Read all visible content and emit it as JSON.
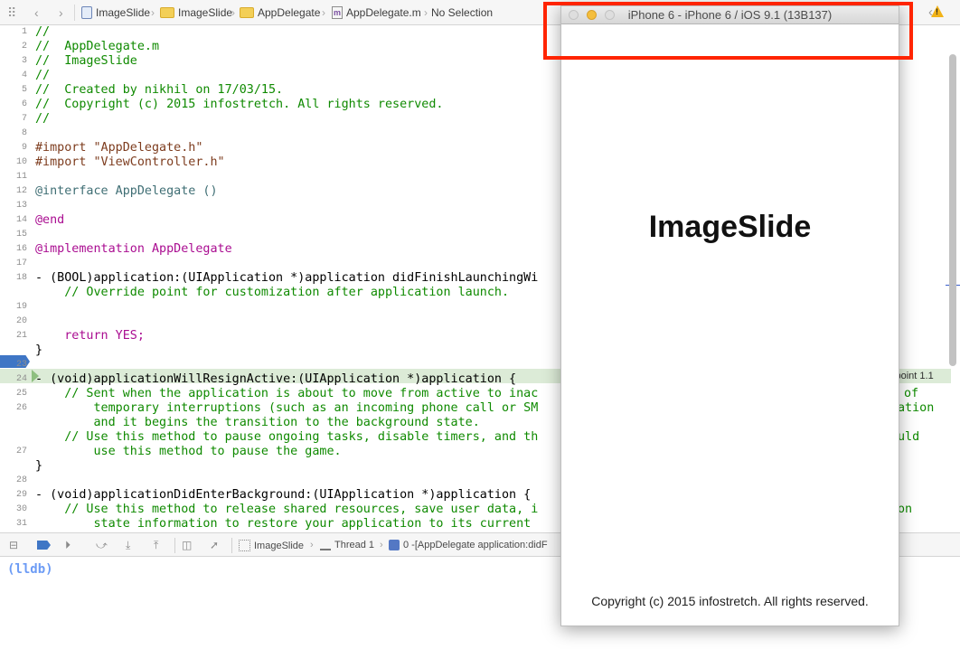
{
  "jumpbar": {
    "crumbs": [
      "ImageSlide",
      "ImageSlide",
      "AppDelegate",
      "AppDelegate.m",
      "No Selection"
    ],
    "warning_icon": "warning-triangle-icon",
    "colors": {
      "warning": "#f2b318"
    }
  },
  "editor": {
    "lines": [
      {
        "n": "1",
        "t": "//"
      },
      {
        "n": "2",
        "t": "//  AppDelegate.m"
      },
      {
        "n": "3",
        "t": "//  ImageSlide"
      },
      {
        "n": "4",
        "t": "//"
      },
      {
        "n": "5",
        "t": "//  Created by nikhil on 17/03/15."
      },
      {
        "n": "6",
        "t": "//  Copyright (c) 2015 infostretch. All rights reserved."
      },
      {
        "n": "7",
        "t": "//"
      },
      {
        "n": "8",
        "t": ""
      },
      {
        "n": "9",
        "t": "#import \"AppDelegate.h\""
      },
      {
        "n": "10",
        "t": "#import \"ViewController.h\""
      },
      {
        "n": "11",
        "t": ""
      },
      {
        "n": "12",
        "t": "@interface AppDelegate ()"
      },
      {
        "n": "13",
        "t": ""
      },
      {
        "n": "14",
        "t": "@end"
      },
      {
        "n": "15",
        "t": ""
      },
      {
        "n": "16",
        "t": "@implementation AppDelegate"
      },
      {
        "n": "17",
        "t": ""
      },
      {
        "n": "18",
        "t": "- (BOOL)application:(UIApplication *)application didFinishLaunchingWi"
      },
      {
        "n": "",
        "t": "    // Override point for customization after application launch."
      },
      {
        "n": "19",
        "t": ""
      },
      {
        "n": "20",
        "t": ""
      },
      {
        "n": "21",
        "t": ""
      },
      {
        "n": "22",
        "t": "    return YES;"
      },
      {
        "n": "",
        "t": "}"
      },
      {
        "n": "23",
        "t": ""
      },
      {
        "n": "24",
        "t": ""
      },
      {
        "n": "25",
        "t": "- (void)applicationWillResignActive:(UIApplication *)application {"
      },
      {
        "n": "26",
        "t": "    // Sent when the application is about to move from active to inac"
      },
      {
        "n": "",
        "t": "        temporary interruptions (such as an incoming phone call or SM"
      },
      {
        "n": "",
        "t": "        and it begins the transition to the background state."
      },
      {
        "n": "27",
        "t": "    // Use this method to pause ongoing tasks, disable timers, and th"
      },
      {
        "n": "",
        "t": "        use this method to pause the game."
      },
      {
        "n": "28",
        "t": "}"
      },
      {
        "n": "29",
        "t": ""
      },
      {
        "n": "30",
        "t": "- (void)applicationDidEnterBackground:(UIApplication *)application {"
      },
      {
        "n": "31",
        "t": "    // Use this method to release shared resources, save user data, i"
      },
      {
        "n": "",
        "t": "        state information to restore your application to its current"
      }
    ],
    "right_fragments": {
      "of": "of",
      "ation": "ation",
      "uld": "uld",
      "on": "on"
    },
    "breakpoint_label": "kpoint 1.1",
    "breakpoint_line": "22",
    "colors": {
      "comment": "#0f8a00",
      "keyword": "#aa0d91",
      "string": "#c41a16",
      "breakpoint": "#3f76c5",
      "pc_line": "#dcebd7"
    }
  },
  "debug_bar": {
    "crumbs": [
      "ImageSlide",
      "Thread 1",
      "0 -[AppDelegate application:didF"
    ]
  },
  "console": {
    "prompt": "(lldb)"
  },
  "simulator": {
    "title": "iPhone 6 - iPhone 6 / iOS 9.1 (13B137)",
    "app_title": "ImageSlide",
    "footer": "Copyright (c) 2015 infostretch. All rights reserved."
  }
}
